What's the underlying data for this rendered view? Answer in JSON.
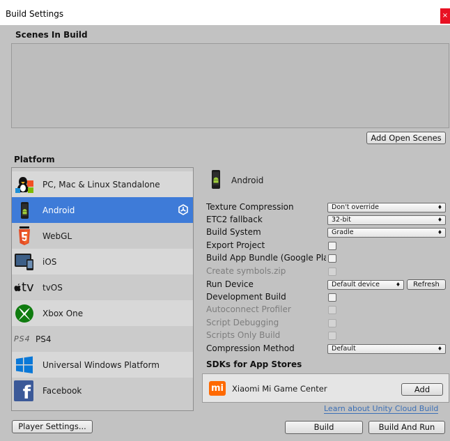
{
  "window": {
    "title": "Build Settings",
    "close_glyph": "×"
  },
  "scenes": {
    "heading": "Scenes In Build",
    "add_open_scenes": "Add Open Scenes"
  },
  "platform": {
    "heading": "Platform",
    "items": [
      {
        "label": "PC, Mac & Linux Standalone",
        "icon": "pc-mac-linux-icon"
      },
      {
        "label": "Android",
        "icon": "android-icon",
        "selected": true
      },
      {
        "label": "WebGL",
        "icon": "html5-icon"
      },
      {
        "label": "iOS",
        "icon": "ios-device-icon"
      },
      {
        "label": "tvOS",
        "icon": "appletv-icon",
        "icon_text": "tv"
      },
      {
        "label": "Xbox One",
        "icon": "xbox-icon"
      },
      {
        "label": "PS4",
        "icon": "ps4-icon",
        "icon_text": "PS4"
      },
      {
        "label": "Universal Windows Platform",
        "icon": "windows-icon"
      },
      {
        "label": "Facebook",
        "icon": "facebook-icon",
        "icon_text": "f"
      }
    ]
  },
  "settings": {
    "platform_title": "Android",
    "texture_compression": {
      "label": "Texture Compression",
      "value": "Don't override"
    },
    "etc2_fallback": {
      "label": "ETC2 fallback",
      "value": "32-bit"
    },
    "build_system": {
      "label": "Build System",
      "value": "Gradle"
    },
    "export_project": {
      "label": "Export Project"
    },
    "build_app_bundle": {
      "label": "Build App Bundle (Google Play)"
    },
    "create_symbols": {
      "label": "Create symbols.zip"
    },
    "run_device": {
      "label": "Run Device",
      "value": "Default device",
      "refresh": "Refresh"
    },
    "development_build": {
      "label": "Development Build"
    },
    "autoconnect_profiler": {
      "label": "Autoconnect Profiler"
    },
    "script_debugging": {
      "label": "Script Debugging"
    },
    "scripts_only_build": {
      "label": "Scripts Only Build"
    },
    "compression_method": {
      "label": "Compression Method",
      "value": "Default"
    }
  },
  "sdks": {
    "heading": "SDKs for App Stores",
    "xiaomi": {
      "label": "Xiaomi Mi Game Center",
      "add": "Add",
      "logo_text": "mi"
    },
    "cloud_link": "Learn about Unity Cloud Build"
  },
  "footer": {
    "player_settings": "Player Settings...",
    "build": "Build",
    "build_and_run": "Build And Run"
  },
  "colors": {
    "selection": "#3e7bd8",
    "panel": "#c2c2c2",
    "link": "#3b6fb6",
    "close": "#e81123"
  }
}
